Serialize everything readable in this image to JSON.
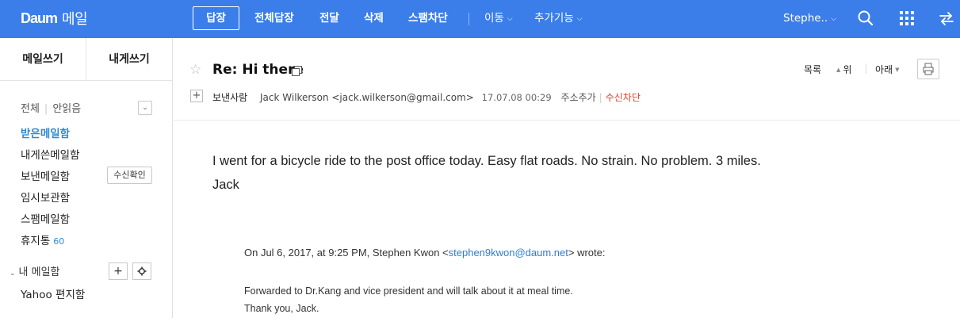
{
  "colors": {
    "topbar": "#3b7de9",
    "accent_blue": "#2c8bd3",
    "block_red": "#e03e2d"
  },
  "header": {
    "logo": "Daum",
    "service": "메일",
    "reply": "답장",
    "reply_all": "전체답장",
    "forward": "전달",
    "delete": "삭제",
    "spam_block": "스팸차단",
    "move": "이동",
    "more": "추가기능",
    "user": "Stephe..",
    "icons": [
      "search-icon",
      "apps-grid-icon",
      "switch-arrows-icon"
    ]
  },
  "sidebar": {
    "write_mail": "메일쓰기",
    "write_to_me": "내게쓰기",
    "filter_all": "전체",
    "filter_unread": "안읽음",
    "folders": [
      {
        "label": "받은메일함"
      },
      {
        "label": "내게쓴메일함"
      },
      {
        "label": "보낸메일함"
      },
      {
        "label": "임시보관함"
      },
      {
        "label": "스팸메일함"
      },
      {
        "label": "휴지통",
        "count": "60"
      }
    ],
    "read_receipt_button": "수신확인",
    "my_mailbox": "내 메일함",
    "yahoo": "Yahoo 편지함"
  },
  "message": {
    "subject": "Re: Hi there",
    "nav": {
      "list": "목록",
      "up": "위",
      "down": "아래"
    },
    "sender_label": "보낸사람",
    "from": "Jack Wilkerson <jack.wilkerson@gmail.com>",
    "date": "17.07.08 00:29",
    "add_address": "주소추가",
    "block_sender": "수신차단",
    "body_line1": "I went for a bicycle ride to the post office today. Easy flat roads. No strain. No problem. 3 miles.",
    "body_line2": "Jack",
    "quote_prefix": "On Jul 6, 2017, at 9:25 PM, Stephen Kwon <",
    "quote_email": "stephen9kwon@daum.net",
    "quote_suffix": "> wrote:",
    "quote_line1": "Forwarded to Dr.Kang and vice president and will talk about it at meal time.",
    "quote_line2": "Thank you, Jack."
  }
}
